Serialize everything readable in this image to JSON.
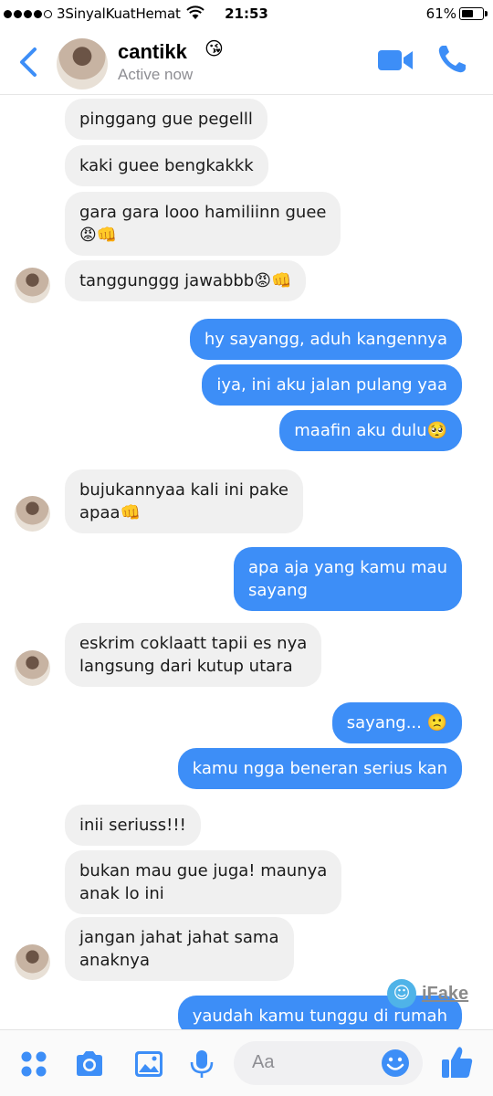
{
  "status_bar": {
    "carrier": "3SinyalKuatHemat",
    "time": "21:53",
    "battery_pct": "61%",
    "battery_level": 0.61
  },
  "header": {
    "name": "cantikk",
    "name_emoji": "😘",
    "status": "Active now",
    "icons": [
      "back-chevron-icon",
      "video-call-icon",
      "phone-call-icon"
    ]
  },
  "messages": [
    {
      "dir": "in",
      "text": "pinggang gue pegelll"
    },
    {
      "dir": "in",
      "text": "kaki guee bengkakkk"
    },
    {
      "dir": "in",
      "text": "gara gara looo hamiliinn guee\n😡👊"
    },
    {
      "dir": "in",
      "text": "tanggunggg jawabbb😡👊",
      "avatar": true
    },
    {
      "dir": "out",
      "text": "hy sayangg, aduh kangennya"
    },
    {
      "dir": "out",
      "text": "iya, ini aku jalan pulang yaa"
    },
    {
      "dir": "out",
      "text": "maafin aku dulu🥺"
    },
    {
      "dir": "in",
      "text": "bujukannyaa kali ini pake\napaa👊",
      "avatar": true
    },
    {
      "dir": "out",
      "text": "apa aja yang kamu mau\nsayang"
    },
    {
      "dir": "in",
      "text": "eskrim coklaatt tapii es nya\nlangsung dari kutup utara",
      "avatar": true
    },
    {
      "dir": "out",
      "text": "sayang... 🙁"
    },
    {
      "dir": "out",
      "text": "kamu ngga beneran serius kan"
    },
    {
      "dir": "in",
      "text": "inii seriuss!!!"
    },
    {
      "dir": "in",
      "text": "bukan mau gue juga! maunya\nanak lo ini"
    },
    {
      "dir": "in",
      "text": "jangan jahat jahat sama\nanaknya",
      "avatar": true
    },
    {
      "dir": "out",
      "text": "yaudah kamu tunggu di rumah"
    }
  ],
  "watermark": {
    "text": "iFake",
    "icon": "smiley-face-icon"
  },
  "composer": {
    "placeholder": "Aa",
    "icons": [
      "apps-grid-icon",
      "camera-icon",
      "gallery-icon",
      "microphone-icon",
      "emoji-icon",
      "thumbs-up-icon"
    ]
  },
  "colors": {
    "accent": "#3d8ef7",
    "incoming_bubble": "#f0f0f0",
    "outgoing_bubble": "#3d8ef7"
  }
}
